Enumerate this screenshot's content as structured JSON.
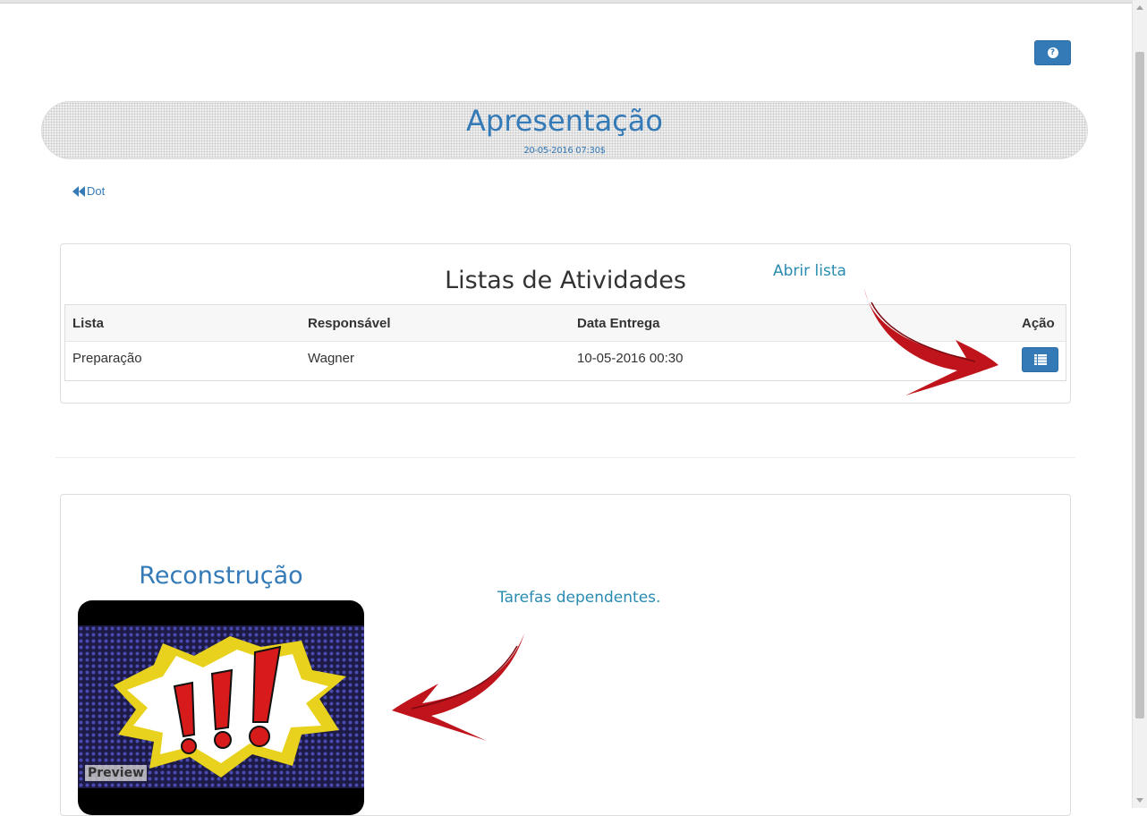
{
  "header": {
    "help_icon": "question-circle-icon",
    "title": "Apresentação",
    "date": "20-05-2016 07:30$",
    "back_icon": "backward-icon",
    "back_label": "Dot"
  },
  "lists_panel": {
    "title": "Listas de Atividades",
    "hint": "Abrir lista",
    "columns": [
      "Lista",
      "Responsável",
      "Data Entrega",
      "Ação"
    ],
    "rows": [
      {
        "lista": "Preparação",
        "responsavel": "Wagner",
        "data_entrega": "10-05-2016 00:30",
        "action_icon": "list-icon"
      }
    ]
  },
  "reconstruction": {
    "title": "Reconstrução",
    "preview_label": "Preview",
    "hint": "Tarefas dependentes."
  },
  "colors": {
    "primary": "#337ab7",
    "hint_text": "#2a8bb0",
    "arrow": "#c0141c"
  }
}
